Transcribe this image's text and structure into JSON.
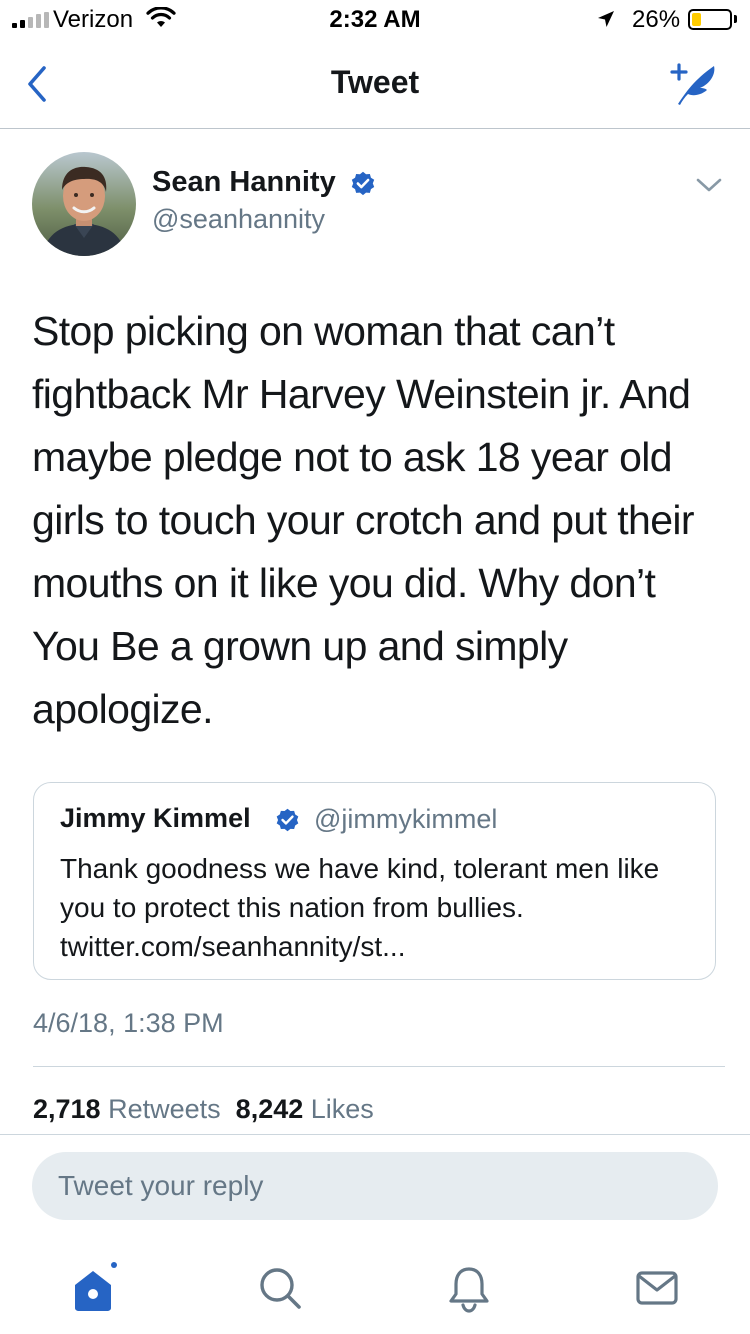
{
  "status_bar": {
    "carrier": "Verizon",
    "time": "2:32 AM",
    "battery_percent": "26%",
    "battery_level": 0.26,
    "signal_bars": 2
  },
  "nav": {
    "title": "Tweet",
    "back_icon": "chevron-left-icon",
    "compose_icon": "compose-tweet-icon"
  },
  "tweet": {
    "author_name": "Sean Hannity",
    "author_handle": "@seanhannity",
    "verified": true,
    "text": "Stop picking on woman that can’t fightback Mr Harvey Weinstein jr. And maybe pledge not to ask 18 year old girls to touch your crotch and put their mouths on it like you did. Why don’t You Be a grown up and simply apologize.",
    "timestamp": "4/6/18, 1:38 PM",
    "retweets_count": "2,718",
    "retweets_label": "Retweets",
    "likes_count": "8,242",
    "likes_label": "Likes"
  },
  "quoted_tweet": {
    "author_name": "Jimmy Kimmel",
    "author_handle": "@jimmykimmel",
    "verified": true,
    "text": "Thank goodness we have kind, tolerant men like you to protect this nation from bullies. twitter.com/seanhannity/st..."
  },
  "reply": {
    "placeholder": "Tweet your reply"
  },
  "colors": {
    "accent": "#1da1f2",
    "icon_blue": "#2664c4",
    "text": "#14171a",
    "secondary_text": "#657786",
    "reply_bg": "#e6ecf0",
    "battery_yellow": "#ffcc00"
  },
  "tab_bar": {
    "items": [
      "home-icon",
      "search-icon",
      "notifications-icon",
      "messages-icon"
    ],
    "active": "home-icon"
  }
}
